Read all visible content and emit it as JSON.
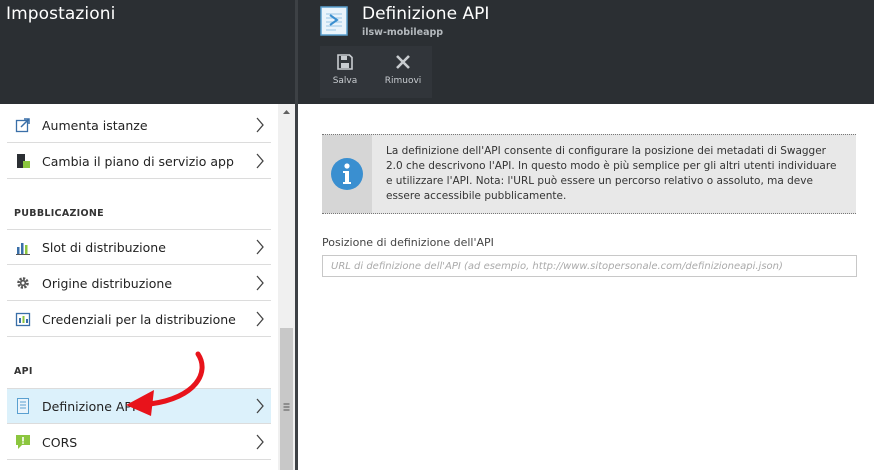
{
  "left": {
    "title": "Impostazioni",
    "items_top": [
      {
        "label": "Aumenta istanze",
        "icon": "scale-up-icon"
      },
      {
        "label": "Cambia il piano di servizio app",
        "icon": "service-plan-icon"
      }
    ],
    "section_publishing": "PUBBLICAZIONE",
    "items_publishing": [
      {
        "label": "Slot di distribuzione",
        "icon": "deployment-slots-icon"
      },
      {
        "label": "Origine distribuzione",
        "icon": "gear-icon"
      },
      {
        "label": "Credenziali per la distribuzione",
        "icon": "credentials-icon"
      }
    ],
    "section_api": "API",
    "items_api": [
      {
        "label": "Definizione API",
        "icon": "api-definition-icon",
        "selected": true
      },
      {
        "label": "CORS",
        "icon": "cors-icon"
      }
    ]
  },
  "right": {
    "title": "Definizione API",
    "subtitle": "ilsw-mobileapp",
    "toolbar": {
      "save_label": "Salva",
      "remove_label": "Rimuovi"
    },
    "info_text": "La definizione dell'API consente di configurare la posizione dei metadati di Swagger 2.0 che descrivono l'API. In questo modo è più semplice per gli altri utenti individuare e utilizzare l'API. Nota: l'URL può essere un percorso relativo o assoluto, ma deve essere accessibile pubblicamente.",
    "field": {
      "label": "Posizione di definizione dell'API",
      "value": "",
      "placeholder": "URL di definizione dell'API (ad esempio, http://www.sitopersonale.com/definizioneapi.json)"
    }
  },
  "colors": {
    "header_bg": "#2b2f33",
    "selected_bg": "#dcf1fb",
    "info_icon": "#3a8fd0",
    "annotation_arrow": "#e8131b"
  }
}
